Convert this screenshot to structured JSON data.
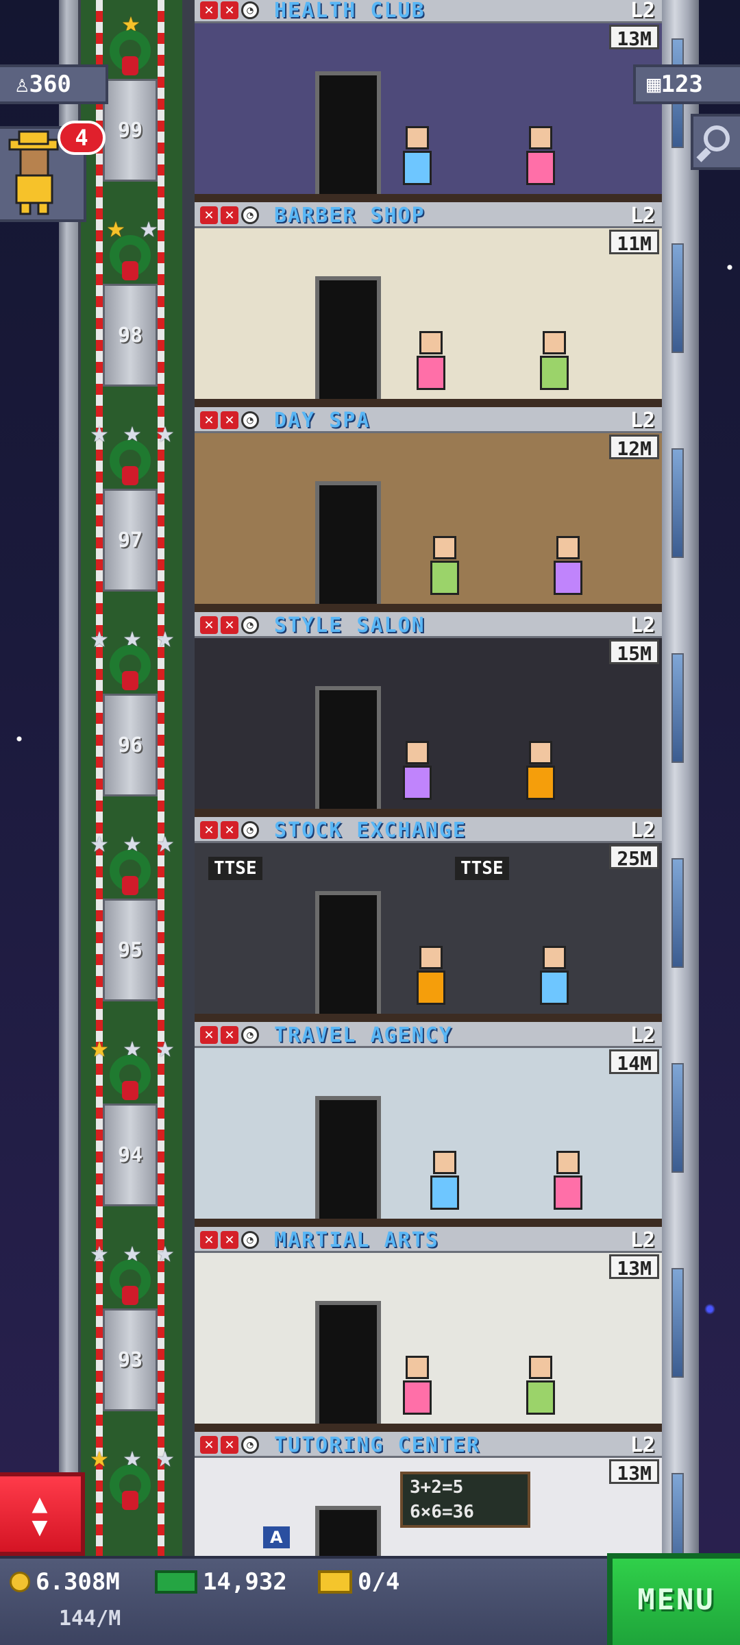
{
  "hud": {
    "population": "360",
    "floor_count": "123",
    "visitor_count": "4"
  },
  "icons": {
    "population": "person-icon",
    "floors": "building-icon",
    "search": "magnifier-icon",
    "coins": "coin-icon",
    "bux": "bux-icon",
    "tickets": "golden-ticket-icon",
    "elevator": "up-down-arrows-icon"
  },
  "elevator_floors": [
    "99",
    "98",
    "97",
    "96",
    "95",
    "94",
    "93"
  ],
  "floors": [
    {
      "name": "HEALTH CLUB",
      "level": "L2",
      "price": "13M",
      "wall": "#4e4a7a",
      "stars": [
        "gold"
      ]
    },
    {
      "name": "BARBER SHOP",
      "level": "L2",
      "price": "11M",
      "wall": "#e6e0cc",
      "stars": [
        "gold",
        "silver"
      ]
    },
    {
      "name": "DAY SPA",
      "level": "L2",
      "price": "12M",
      "wall": "#9a7a52",
      "stars": [
        "silver",
        "silver",
        "silver"
      ]
    },
    {
      "name": "STYLE SALON",
      "level": "L2",
      "price": "15M",
      "wall": "#2f2e36",
      "stars": [
        "silver",
        "silver",
        "silver"
      ]
    },
    {
      "name": "STOCK EXCHANGE",
      "level": "L2",
      "price": "25M",
      "wall": "#3a3b42",
      "stars": [
        "silver",
        "silver",
        "silver"
      ]
    },
    {
      "name": "TRAVEL AGENCY",
      "level": "L2",
      "price": "14M",
      "wall": "#c9d4dc",
      "stars": [
        "gold",
        "silver",
        "silver"
      ]
    },
    {
      "name": "MARTIAL ARTS",
      "level": "L2",
      "price": "13M",
      "wall": "#e6e6e0",
      "stars": [
        "silver",
        "silver",
        "silver"
      ]
    },
    {
      "name": "TUTORING CENTER",
      "level": "L2",
      "price": "13M",
      "wall": "#e8e8ec",
      "stars": [
        "gold",
        "silver",
        "silver"
      ]
    }
  ],
  "decor_text": {
    "ttse_1": "TTSE",
    "ttse_2": "TTSE",
    "chalkboard_1": "3+2=5",
    "chalkboard_2": "6×6=36",
    "apple_label": "A"
  },
  "bottom_bar": {
    "coins": "6.308M",
    "rate": "144/M",
    "bux": "14,932",
    "tickets": "0/4",
    "menu_label": "MENU"
  },
  "colors": {
    "floor_name": "#59b6f5",
    "menu_button": "#22b83f",
    "elevator_button": "#e01e2e"
  }
}
